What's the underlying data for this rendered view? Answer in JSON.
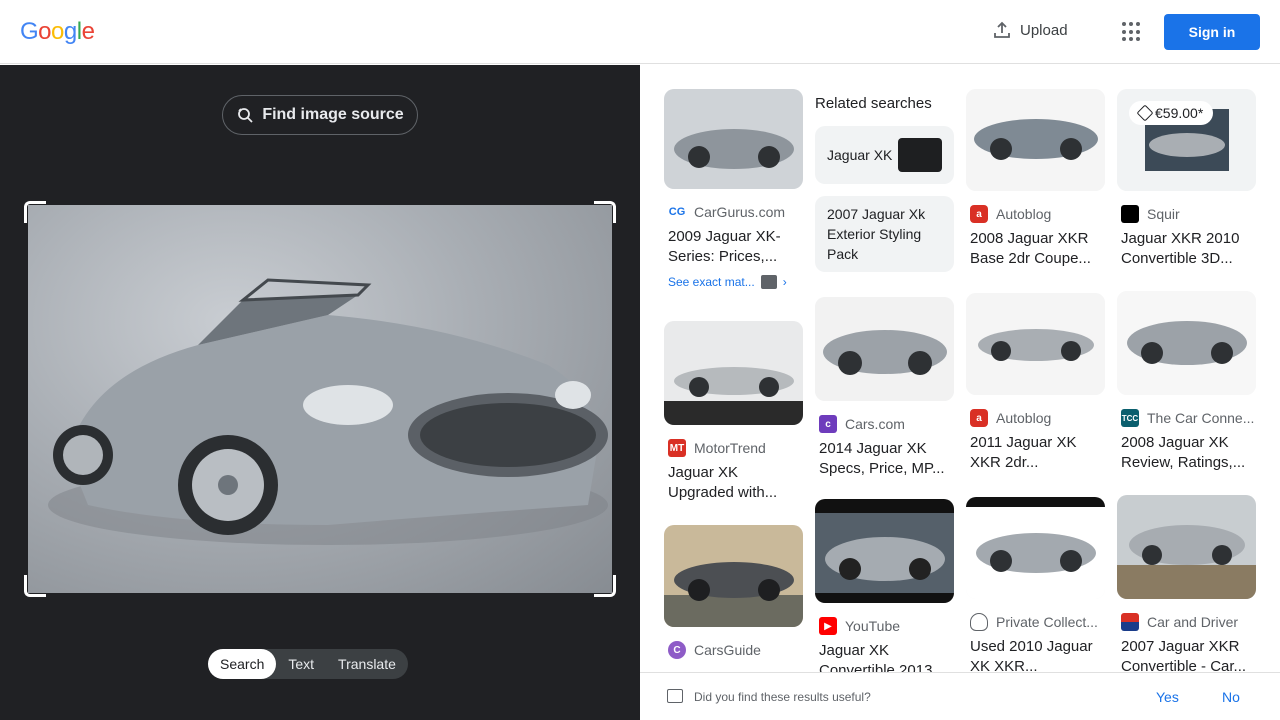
{
  "header": {
    "logo": "Google",
    "upload_label": "Upload",
    "signin_label": "Sign in"
  },
  "left_panel": {
    "find_source_label": "Find image source",
    "tabs": [
      {
        "label": "Search",
        "active": true
      },
      {
        "label": "Text",
        "active": false
      },
      {
        "label": "Translate",
        "active": false
      }
    ]
  },
  "related": {
    "heading": "Related searches",
    "chips": [
      "Jaguar XK",
      "2007 Jaguar Xk Exterior Styling Pack"
    ]
  },
  "results": [
    {
      "source": "CarGurus.com",
      "title": "2009 Jaguar XK-Series: Prices,...",
      "exact_match": "See exact mat..."
    },
    {
      "source": "MotorTrend",
      "title": "Jaguar XK Upgraded with..."
    },
    {
      "source": "CarsGuide",
      "title": ""
    },
    {
      "source": "Cars.com",
      "title": "2014 Jaguar XK Specs, Price, MP..."
    },
    {
      "source": "YouTube",
      "title": "Jaguar XK Convertible 2013..."
    },
    {
      "source": "Autoblog",
      "title": "2008 Jaguar XKR Base 2dr Coupe..."
    },
    {
      "source": "Autoblog",
      "title": "2011 Jaguar XK XKR 2dr..."
    },
    {
      "source": "Private Collect...",
      "title": "Used 2010 Jaguar XK XKR..."
    },
    {
      "source": "Squir",
      "title": "Jaguar XKR 2010 Convertible 3D...",
      "price": "€59.00*"
    },
    {
      "source": "The Car Conne...",
      "title": "2008 Jaguar XK Review, Ratings,..."
    },
    {
      "source": "Car and Driver",
      "title": "2007 Jaguar XKR Convertible - Car..."
    }
  ],
  "feedback": {
    "question": "Did you find these results useful?",
    "yes": "Yes",
    "no": "No"
  },
  "colors": {
    "accent": "#1a73e8",
    "dark_panel": "#202124"
  }
}
